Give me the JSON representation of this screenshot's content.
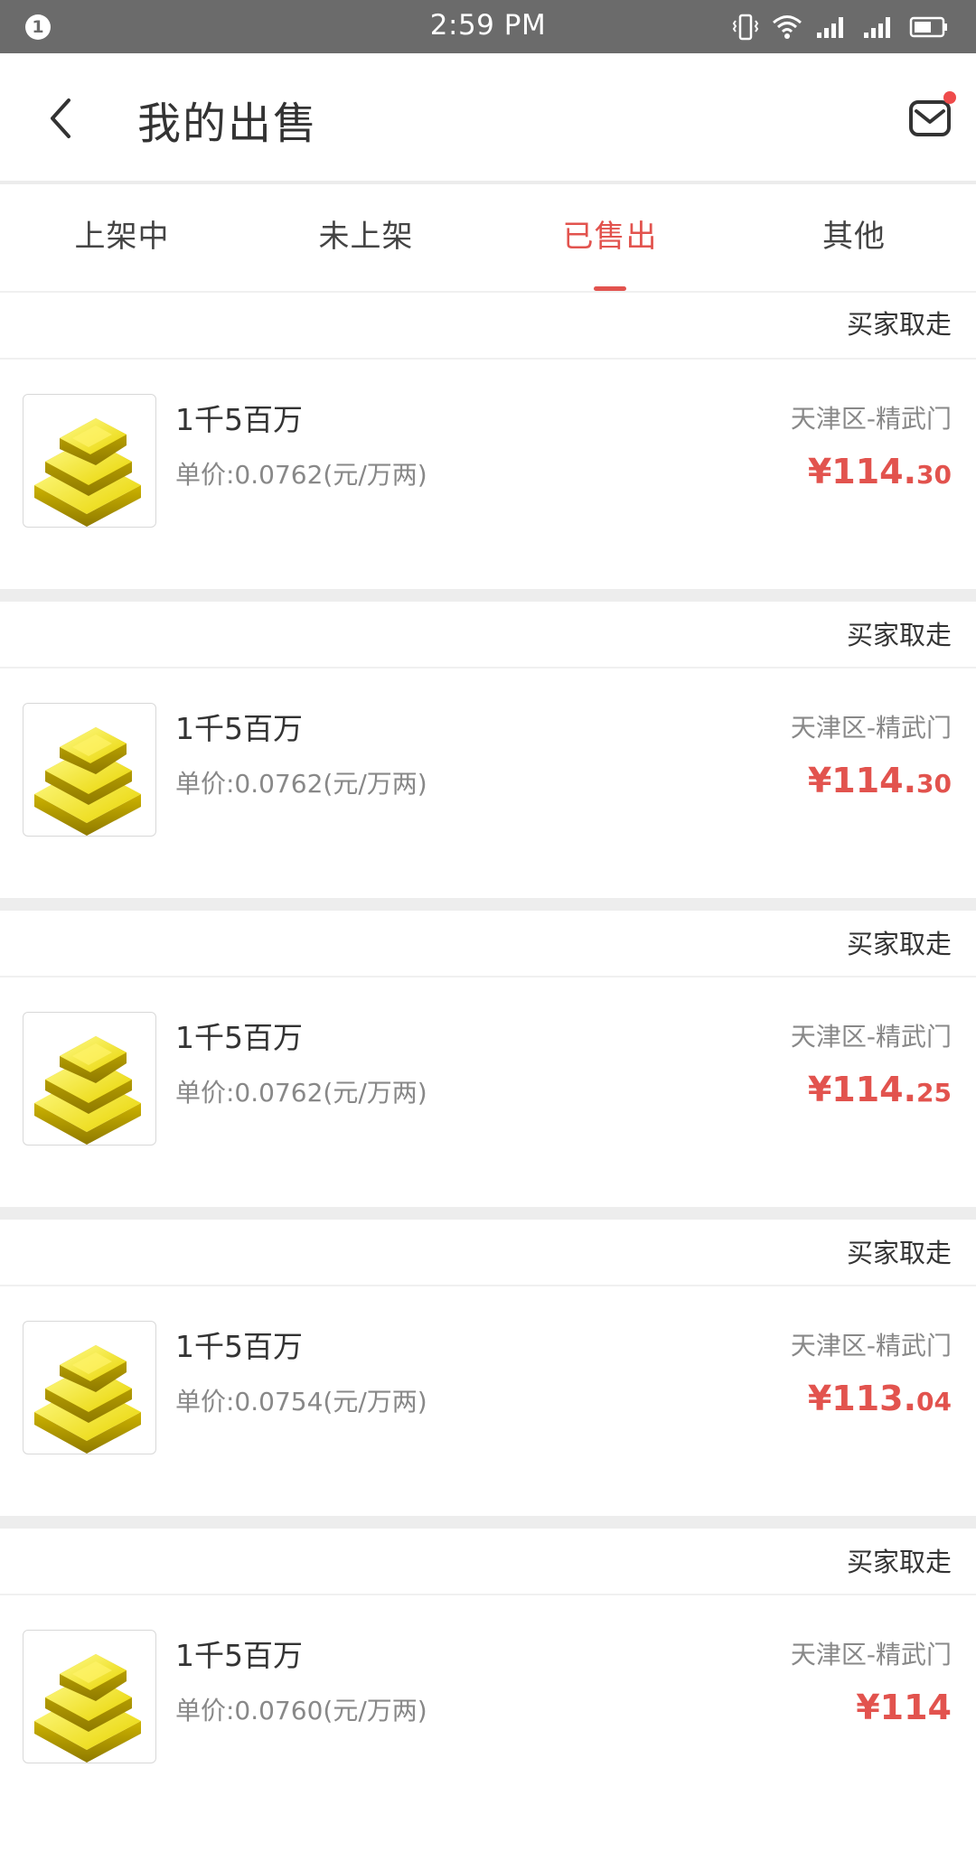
{
  "status_bar": {
    "notification_count": "1",
    "time": "2:59 PM",
    "icons": [
      "vibrate-icon",
      "wifi-icon",
      "signal-icon",
      "signal-2-icon",
      "battery-icon"
    ]
  },
  "header": {
    "title": "我的出售",
    "back_icon": "back-chevron-icon",
    "mail_icon": "mail-icon",
    "has_unread": true
  },
  "tabs": [
    {
      "label": "上架中",
      "active": false
    },
    {
      "label": "未上架",
      "active": false
    },
    {
      "label": "已售出",
      "active": true
    },
    {
      "label": "其他",
      "active": false
    }
  ],
  "colors": {
    "accent": "#e2534e",
    "status_bar": "#6b6b6b",
    "gold": "#f2e21a"
  },
  "orders": [
    {
      "status": "买家取走",
      "title": "1千5百万",
      "unit_price": "单价:0.0762(元/万两)",
      "server": "天津区-精武门",
      "price_currency": "¥",
      "price_int": "114.",
      "price_dec": "30"
    },
    {
      "status": "买家取走",
      "title": "1千5百万",
      "unit_price": "单价:0.0762(元/万两)",
      "server": "天津区-精武门",
      "price_currency": "¥",
      "price_int": "114.",
      "price_dec": "30"
    },
    {
      "status": "买家取走",
      "title": "1千5百万",
      "unit_price": "单价:0.0762(元/万两)",
      "server": "天津区-精武门",
      "price_currency": "¥",
      "price_int": "114.",
      "price_dec": "25"
    },
    {
      "status": "买家取走",
      "title": "1千5百万",
      "unit_price": "单价:0.0754(元/万两)",
      "server": "天津区-精武门",
      "price_currency": "¥",
      "price_int": "113.",
      "price_dec": "04"
    },
    {
      "status": "买家取走",
      "title": "1千5百万",
      "unit_price": "单价:0.0760(元/万两)",
      "server": "天津区-精武门",
      "price_currency": "¥",
      "price_int": "114",
      "price_dec": ""
    }
  ]
}
